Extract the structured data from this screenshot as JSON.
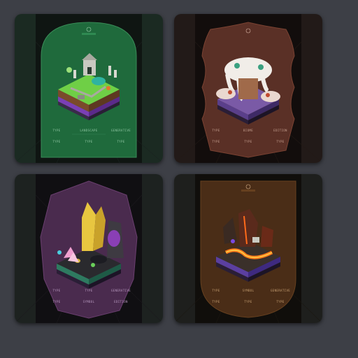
{
  "cards": [
    {
      "id": "forest",
      "colors": {
        "frame": "#1b2a22",
        "panel": "#0f1512",
        "plaque": "#1f6a3c",
        "plaqueLight": "#2e8a50",
        "text": "#8fc6a2"
      },
      "stats_row1": [
        "TYPE",
        "LANDSCAPE",
        "GENERATIVE"
      ],
      "stats_row2": [
        "TYPE",
        "TYPE",
        "TYPE"
      ]
    },
    {
      "id": "snow",
      "colors": {
        "frame": "#221a18",
        "panel": "#120d0c",
        "plaque": "#5a3026",
        "plaqueLight": "#7a4232",
        "text": "#c7a191"
      },
      "stats_row1": [
        "TYPE",
        "BIOME",
        "EDITION"
      ],
      "stats_row2": [
        "TYPE",
        "TYPE",
        "TYPE"
      ]
    },
    {
      "id": "crystal",
      "colors": {
        "frame": "#1d2220",
        "panel": "#100f12",
        "plaque": "#4a2b4e",
        "plaqueLight": "#6a3f6f",
        "text": "#b99ac0"
      },
      "stats_row1": [
        "TYPE",
        "TYPE",
        "GENERATIVE"
      ],
      "stats_row2": [
        "TYPE",
        "SYMBOL",
        "EDITION"
      ]
    },
    {
      "id": "lava",
      "colors": {
        "frame": "#1e1f1d",
        "panel": "#100e0b",
        "plaque": "#4a2d17",
        "plaqueLight": "#66401f",
        "text": "#c8a173"
      },
      "stats_row1": [
        "TYPE",
        "SYMBOL",
        "GENERATIVE"
      ],
      "stats_row2": [
        "TYPE",
        "TYPE",
        "TYPE"
      ]
    }
  ]
}
